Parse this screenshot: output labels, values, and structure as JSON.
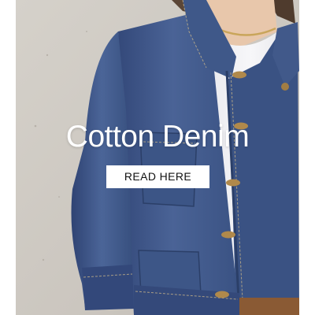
{
  "banner": {
    "headline": "Cotton Denim",
    "cta_label": "READ HERE",
    "image_subject": "model-wearing-cropped-denim-jacket",
    "colors": {
      "wall": "#cfcac3",
      "denim": "#3c5585",
      "denim_dark": "#2b3f68",
      "tshirt": "#f4f4f6",
      "skin": "#e6c4a8",
      "gold": "#c9a55a",
      "text": "#ffffff",
      "button_bg": "#ffffff",
      "button_text": "#111111"
    }
  }
}
